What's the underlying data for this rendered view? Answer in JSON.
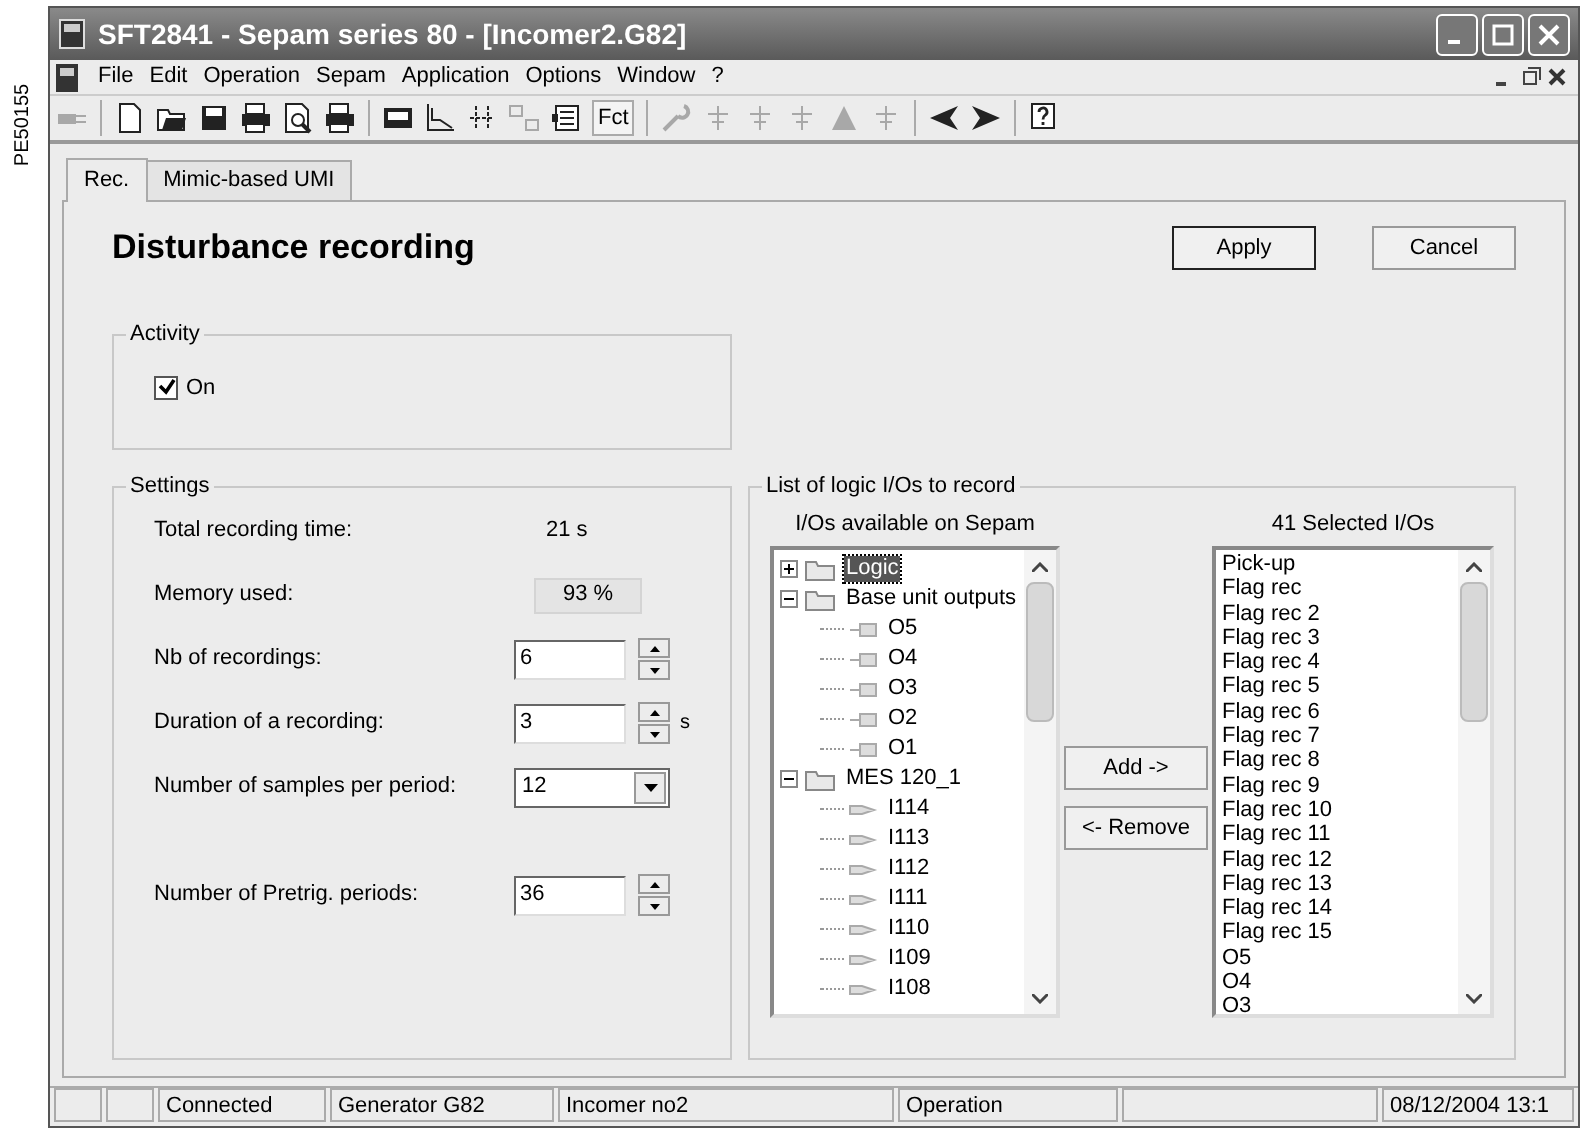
{
  "figure_code": "PE50155",
  "window": {
    "title": "SFT2841 - Sepam series 80 - [Incomer2.G82]"
  },
  "menu": [
    "File",
    "Edit",
    "Operation",
    "Sepam",
    "Application",
    "Options",
    "Window",
    "?"
  ],
  "toolbar": [
    {
      "kind": "plug",
      "disabled": true
    },
    {
      "kind": "sep"
    },
    {
      "kind": "new",
      "disabled": false
    },
    {
      "kind": "open",
      "disabled": false
    },
    {
      "kind": "save",
      "disabled": false
    },
    {
      "kind": "printer",
      "disabled": false
    },
    {
      "kind": "preview",
      "disabled": false
    },
    {
      "kind": "printer",
      "disabled": false
    },
    {
      "kind": "sep"
    },
    {
      "kind": "monitor",
      "disabled": false
    },
    {
      "kind": "curve",
      "disabled": false
    },
    {
      "kind": "switch",
      "disabled": false
    },
    {
      "kind": "blocks",
      "disabled": true
    },
    {
      "kind": "panel",
      "disabled": false
    },
    {
      "kind": "text",
      "label": "Fct",
      "disabled": false
    },
    {
      "kind": "sep"
    },
    {
      "kind": "wrench",
      "disabled": true
    },
    {
      "kind": "sym",
      "disabled": true
    },
    {
      "kind": "sym",
      "disabled": true
    },
    {
      "kind": "sym",
      "disabled": true
    },
    {
      "kind": "triangle",
      "disabled": true
    },
    {
      "kind": "sym",
      "disabled": true
    },
    {
      "kind": "sep"
    },
    {
      "kind": "left",
      "disabled": false
    },
    {
      "kind": "right",
      "disabled": false
    },
    {
      "kind": "sep"
    },
    {
      "kind": "help",
      "disabled": false
    }
  ],
  "tabs": [
    {
      "label": "Rec.",
      "selected": true
    },
    {
      "label": "Mimic-based UMI",
      "selected": false
    }
  ],
  "page_title": "Disturbance recording",
  "buttons": [
    "Apply",
    "Cancel"
  ],
  "activity": {
    "title": "Activity",
    "checkbox": {
      "label": "On",
      "checked": true
    }
  },
  "settings": {
    "title": "Settings",
    "rows": [
      {
        "kind": "text",
        "label": "Total recording time:",
        "value": "21 s"
      },
      {
        "kind": "readout",
        "label": "Memory used:",
        "value": "93 %"
      },
      {
        "kind": "spin",
        "label": "Nb of recordings:",
        "value": "6"
      },
      {
        "kind": "spin",
        "label": "Duration of a recording:",
        "value": "3",
        "unit": "s"
      },
      {
        "kind": "dropdown",
        "label": "Number of samples per period:",
        "value": "12"
      },
      {
        "kind": "spin",
        "label": "Number of Pretrig. periods:",
        "value": "36"
      }
    ]
  },
  "io_list": {
    "title": "List of logic I/Os to record",
    "available_label": "I/Os available on Sepam",
    "selected_label": "41 Selected I/Os",
    "tree": [
      {
        "label": "Logic",
        "kind": "folder",
        "expanded": false,
        "selected": true
      },
      {
        "label": "Base unit outputs",
        "kind": "folder",
        "expanded": true,
        "selected": false,
        "children": [
          {
            "label": "O5",
            "kind": "output",
            "selected": false
          },
          {
            "label": "O4",
            "kind": "output",
            "selected": false
          },
          {
            "label": "O3",
            "kind": "output",
            "selected": false
          },
          {
            "label": "O2",
            "kind": "output",
            "selected": false
          },
          {
            "label": "O1",
            "kind": "output",
            "selected": false
          }
        ]
      },
      {
        "label": "MES 120_1",
        "kind": "folder",
        "expanded": true,
        "selected": false,
        "children": [
          {
            "label": "I114",
            "kind": "input",
            "selected": false
          },
          {
            "label": "I113",
            "kind": "input",
            "selected": false
          },
          {
            "label": "I112",
            "kind": "input",
            "selected": false
          },
          {
            "label": "I111",
            "kind": "input",
            "selected": false
          },
          {
            "label": "I110",
            "kind": "input",
            "selected": false
          },
          {
            "label": "I109",
            "kind": "input",
            "selected": false
          },
          {
            "label": "I108",
            "kind": "input",
            "selected": false
          }
        ]
      }
    ],
    "add_button": "Add ->",
    "remove_button": "<- Remove",
    "selected": [
      "Pick-up",
      "Flag rec",
      "Flag rec 2",
      "Flag rec 3",
      "Flag rec 4",
      "Flag rec 5",
      "Flag rec 6",
      "Flag rec 7",
      "Flag rec 8",
      "Flag rec 9",
      "Flag rec 10",
      "Flag rec 11",
      "Flag rec 12",
      "Flag rec 13",
      "Flag rec 14",
      "Flag rec 15",
      "O5",
      "O4",
      "O3"
    ]
  },
  "status_bar": [
    "Connected",
    "Generator G82",
    "Incomer no2",
    "Operation",
    "08/12/2004 13:1"
  ]
}
